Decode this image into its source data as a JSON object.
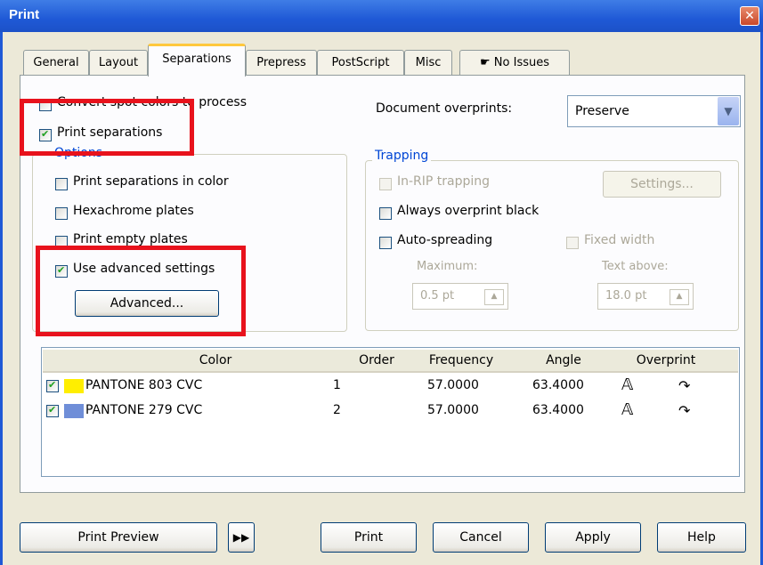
{
  "window": {
    "title": "Print",
    "close_label": "✕"
  },
  "tabs": [
    "General",
    "Layout",
    "Separations",
    "Prepress",
    "PostScript",
    "Misc",
    "No Issues"
  ],
  "left": {
    "convert_spot": "Convert spot colors to process",
    "print_separations": "Print separations",
    "options_label": "Options",
    "in_color": "Print separations in color",
    "hexachrome": "Hexachrome plates",
    "empty_plates": "Print empty plates",
    "advanced_settings": "Use advanced settings",
    "advanced_button": "Advanced..."
  },
  "right": {
    "doc_overprints_label": "Document overprints:",
    "doc_overprints_value": "Preserve",
    "trapping_label": "Trapping",
    "in_rip": "In-RIP trapping",
    "settings_button": "Settings...",
    "always_overprint": "Always overprint black",
    "auto_spreading": "Auto-spreading",
    "fixed_width": "Fixed width",
    "maximum_label": "Maximum:",
    "maximum_value": "0.5 pt",
    "text_above_label": "Text above:",
    "text_above_value": "18.0 pt"
  },
  "table": {
    "headers": [
      "Color",
      "Order",
      "Frequency",
      "Angle",
      "Overprint"
    ],
    "rows": [
      {
        "name": "PANTONE 803 CVC",
        "swatch": "#ffee00",
        "order": "1",
        "frequency": "57.0000",
        "angle": "63.4000"
      },
      {
        "name": "PANTONE 279 CVC",
        "swatch": "#6f8ed8",
        "order": "2",
        "frequency": "57.0000",
        "angle": "63.4000"
      }
    ]
  },
  "footer": {
    "print_preview": "Print Preview",
    "print": "Print",
    "cancel": "Cancel",
    "apply": "Apply",
    "help": "Help"
  },
  "colors": {
    "highlight": "#e8121c",
    "title_bar": "#1f59d6",
    "group_label": "#0046d5"
  }
}
